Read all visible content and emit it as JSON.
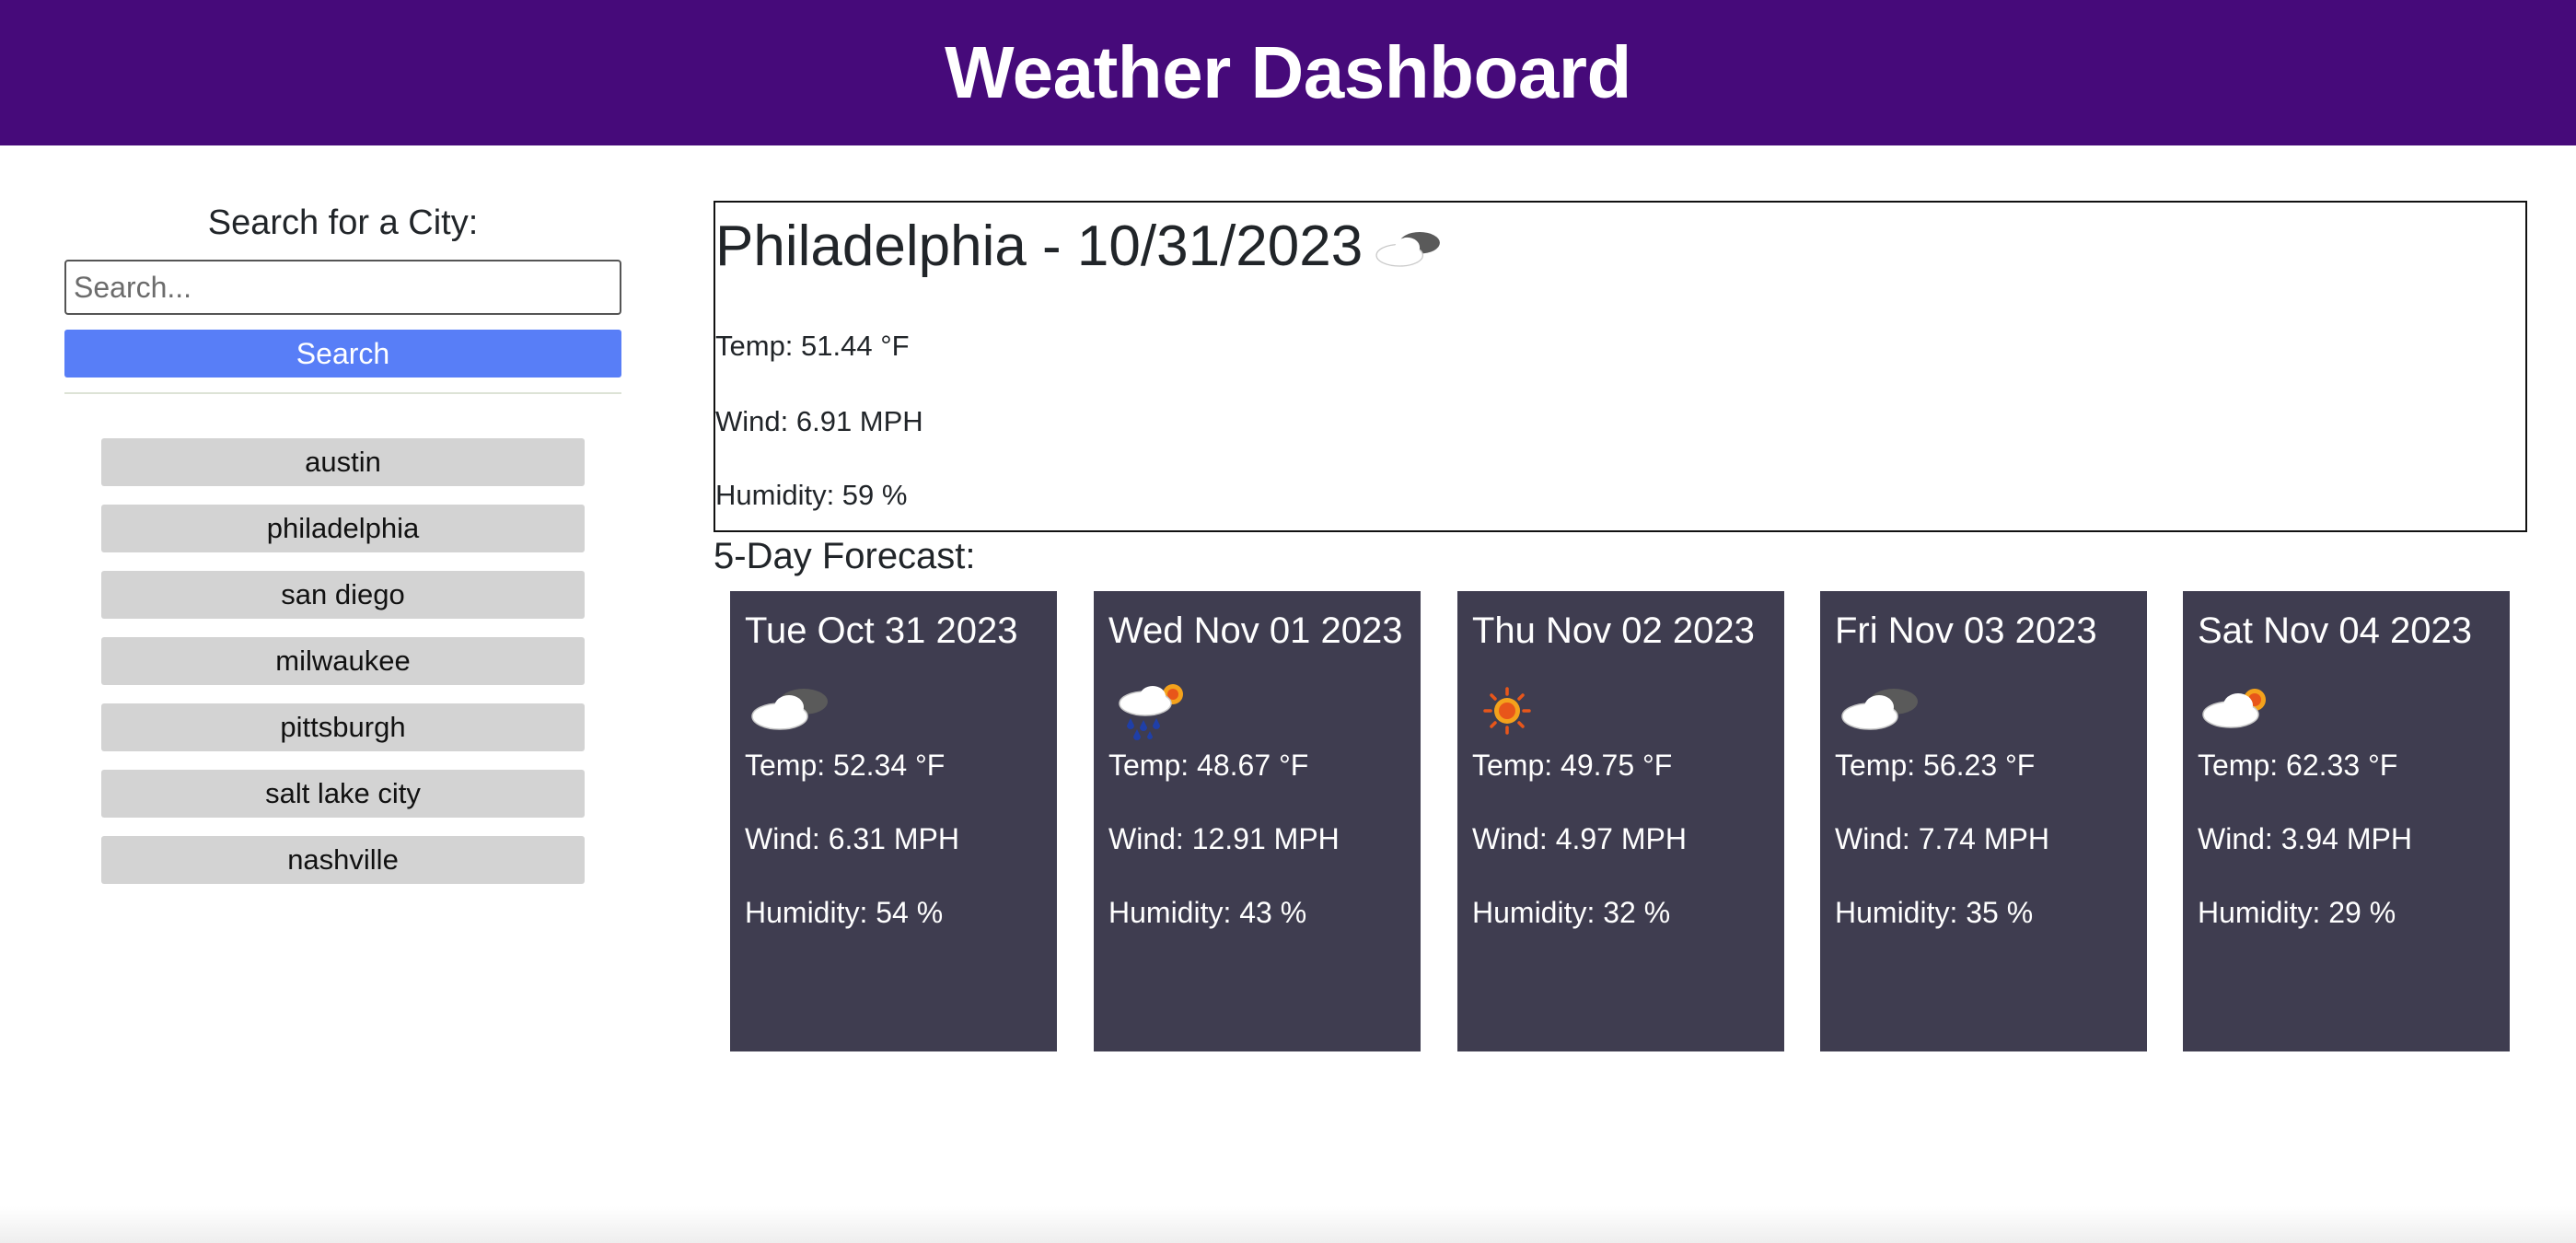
{
  "header": {
    "title": "Weather Dashboard"
  },
  "search": {
    "heading": "Search for a City:",
    "placeholder": "Search...",
    "button_label": "Search",
    "history": [
      "austin",
      "philadelphia",
      "san diego",
      "milwaukee",
      "pittsburgh",
      "salt lake city",
      "nashville"
    ]
  },
  "current": {
    "title": "Philadelphia - 10/31/2023",
    "icon": "cloud-icon",
    "temp": "Temp: 51.44 °F",
    "wind": "Wind: 6.91 MPH",
    "humidity": "Humidity: 59 %"
  },
  "forecast": {
    "heading": "5-Day Forecast:",
    "days": [
      {
        "date": "Tue Oct 31 2023",
        "icon": "cloud-icon",
        "temp": "Temp: 52.34 °F",
        "wind": "Wind: 6.31 MPH",
        "humidity": "Humidity: 54 %"
      },
      {
        "date": "Wed Nov 01 2023",
        "icon": "rain-sun-icon",
        "temp": "Temp: 48.67 °F",
        "wind": "Wind: 12.91 MPH",
        "humidity": "Humidity: 43 %"
      },
      {
        "date": "Thu Nov 02 2023",
        "icon": "sun-icon",
        "temp": "Temp: 49.75 °F",
        "wind": "Wind: 4.97 MPH",
        "humidity": "Humidity: 32 %"
      },
      {
        "date": "Fri Nov 03 2023",
        "icon": "cloud-icon",
        "temp": "Temp: 56.23 °F",
        "wind": "Wind: 7.74 MPH",
        "humidity": "Humidity: 35 %"
      },
      {
        "date": "Sat Nov 04 2023",
        "icon": "partly-cloudy-icon",
        "temp": "Temp: 62.33 °F",
        "wind": "Wind: 3.94 MPH",
        "humidity": "Humidity: 29 %"
      }
    ]
  },
  "colors": {
    "header_bg": "#460a7a",
    "search_button": "#587ef7",
    "history_button": "#d3d3d3",
    "forecast_card_bg": "#3f3d50"
  }
}
